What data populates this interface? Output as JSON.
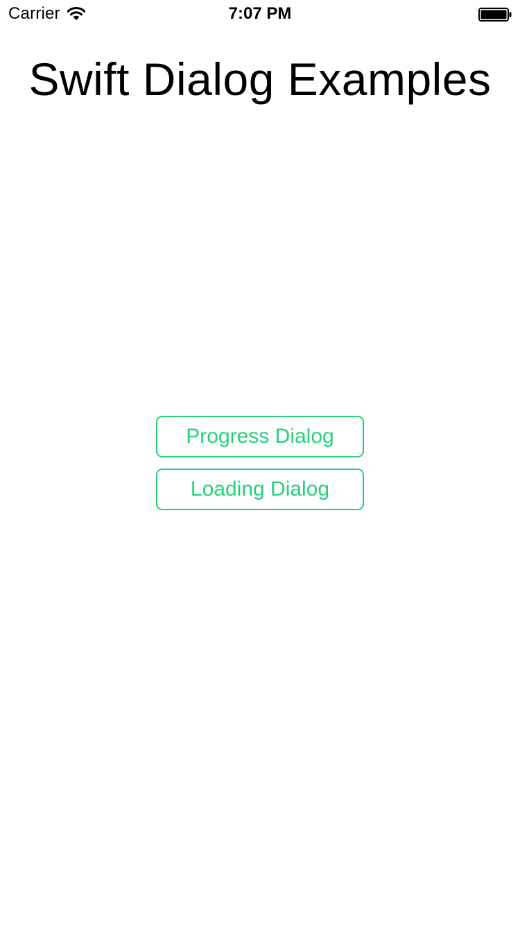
{
  "status_bar": {
    "carrier": "Carrier",
    "time": "7:07 PM",
    "wifi_icon": "wifi-icon",
    "battery_icon": "battery-full-icon"
  },
  "main": {
    "title": "Swift Dialog Examples",
    "buttons": [
      {
        "label": "Progress Dialog"
      },
      {
        "label": "Loading Dialog"
      }
    ]
  },
  "colors": {
    "accent": "#26d07c",
    "text": "#000000",
    "background": "#ffffff"
  }
}
